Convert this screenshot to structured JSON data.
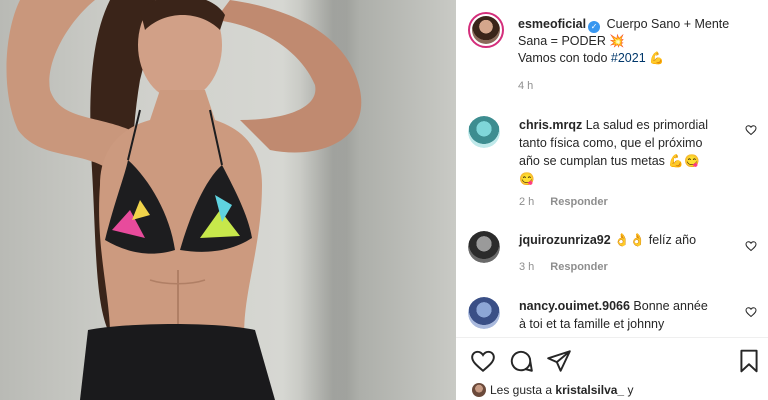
{
  "post": {
    "username": "esmeoficial",
    "caption_line1": "Cuerpo Sano + Mente",
    "caption_line2": "Sana = PODER 💥",
    "caption_line3_prefix": "Vamos con todo",
    "caption_hashtag": "#2021",
    "caption_emoji": "💪",
    "time": "4 h"
  },
  "comments": [
    {
      "username": "chris.mrqz",
      "line1": "La salud es primordial",
      "line2": "tanto física como, que el próximo",
      "line3": "año se cumplan tus metas 💪😋",
      "line4": "😋",
      "time": "2 h",
      "reply_label": "Responder"
    },
    {
      "username": "jquirozunriza92",
      "line1": "👌👌 felíz año",
      "time": "3 h",
      "reply_label": "Responder"
    },
    {
      "username": "nancy.ouimet.9066",
      "line1": "Bonne année",
      "line2": "à toi et ta famille et johnny"
    }
  ],
  "likes": {
    "prefix": "Les gusta a",
    "user": "kristalsilva_",
    "suffix": "y"
  },
  "colors": {
    "accent_link": "#00376b",
    "verified": "#3897f0",
    "story_ring": "#d42e7b",
    "muted": "#8e8e8e"
  },
  "icons": [
    "verified-badge-icon",
    "heart-icon",
    "comment-icon",
    "share-icon",
    "bookmark-icon"
  ]
}
